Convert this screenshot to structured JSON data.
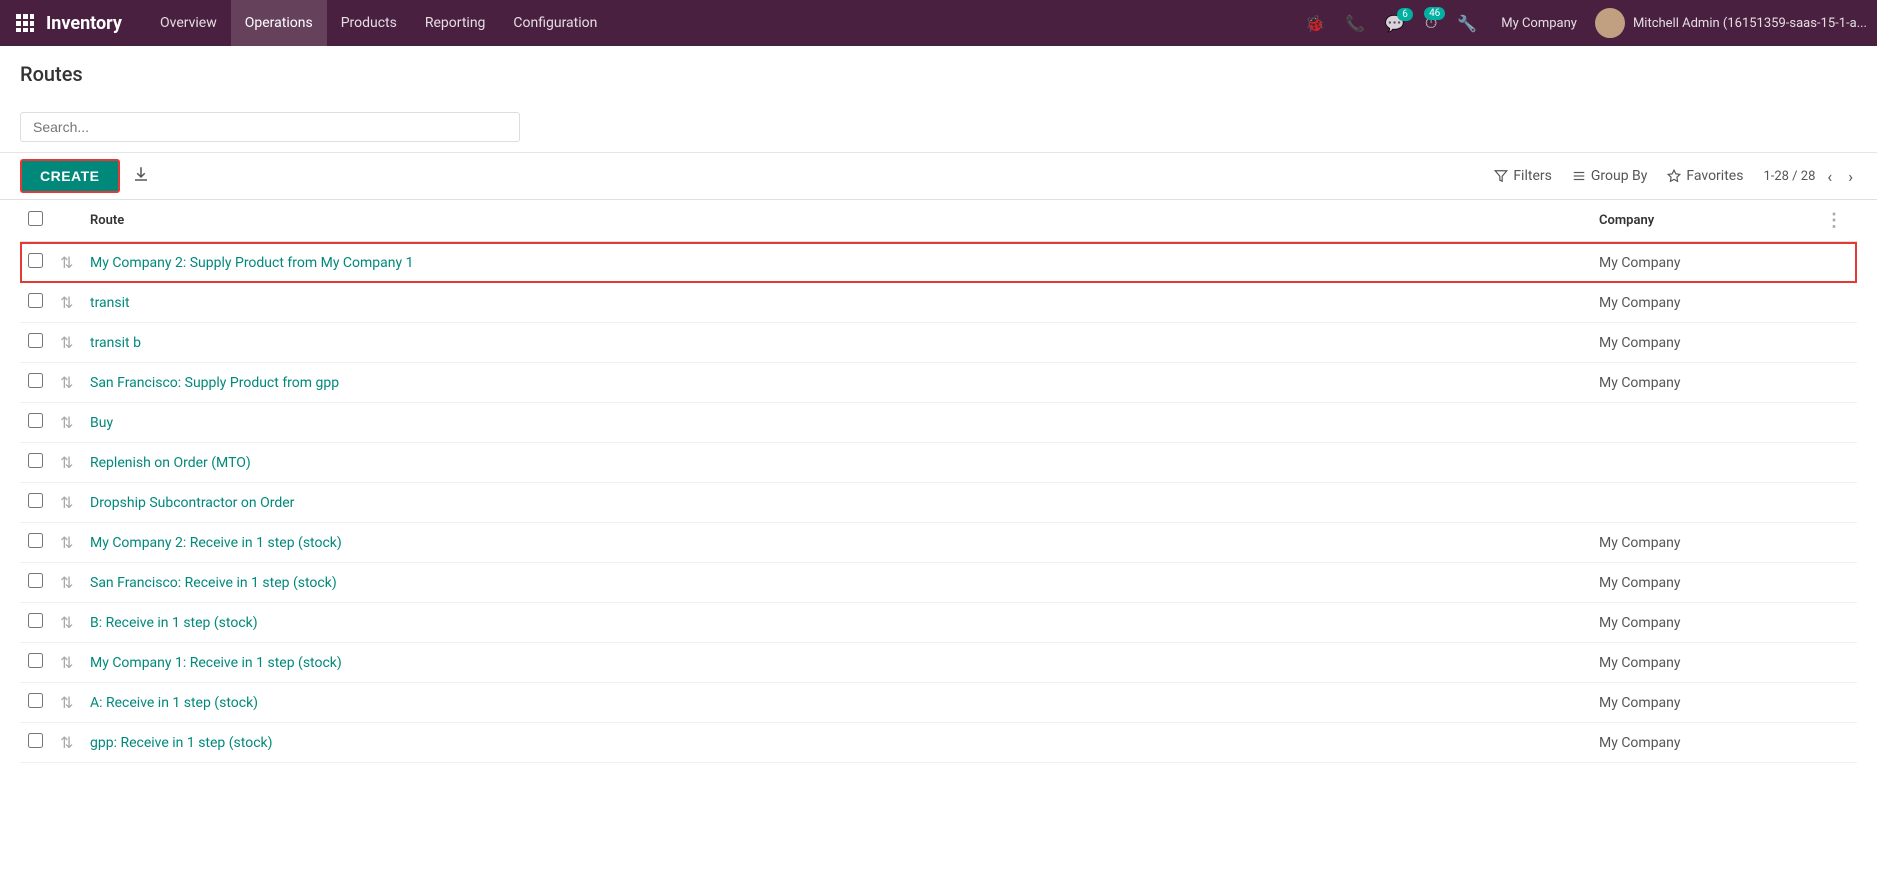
{
  "app": {
    "brand": "Inventory",
    "grid_icon": "⊞"
  },
  "nav": {
    "items": [
      {
        "label": "Overview",
        "active": false
      },
      {
        "label": "Operations",
        "active": false
      },
      {
        "label": "Products",
        "active": false
      },
      {
        "label": "Reporting",
        "active": false
      },
      {
        "label": "Configuration",
        "active": false
      }
    ]
  },
  "topnav_right": {
    "bug_icon": "🐞",
    "phone_icon": "📞",
    "chat_icon": "💬",
    "chat_badge": "6",
    "clock_icon": "⏰",
    "clock_badge": "46",
    "wrench_icon": "🔧",
    "company": "My Company",
    "username": "Mitchell Admin (16151359-saas-15-1-a..."
  },
  "page": {
    "title": "Routes",
    "search_placeholder": "Search..."
  },
  "toolbar": {
    "create_label": "CREATE",
    "filters_label": "Filters",
    "group_by_label": "Group By",
    "favorites_label": "Favorites",
    "pagination": "1-28 / 28"
  },
  "table": {
    "columns": [
      {
        "key": "route",
        "label": "Route"
      },
      {
        "key": "company",
        "label": "Company"
      }
    ],
    "rows": [
      {
        "id": 1,
        "route": "My Company 2: Supply Product from My Company 1",
        "company": "My Company",
        "highlighted": true
      },
      {
        "id": 2,
        "route": "transit",
        "company": "My Company",
        "highlighted": false
      },
      {
        "id": 3,
        "route": "transit b",
        "company": "My Company",
        "highlighted": false
      },
      {
        "id": 4,
        "route": "San Francisco: Supply Product from gpp",
        "company": "My Company",
        "highlighted": false
      },
      {
        "id": 5,
        "route": "Buy",
        "company": "",
        "highlighted": false
      },
      {
        "id": 6,
        "route": "Replenish on Order (MTO)",
        "company": "",
        "highlighted": false
      },
      {
        "id": 7,
        "route": "Dropship Subcontractor on Order",
        "company": "",
        "highlighted": false
      },
      {
        "id": 8,
        "route": "My Company 2: Receive in 1 step (stock)",
        "company": "My Company",
        "highlighted": false
      },
      {
        "id": 9,
        "route": "San Francisco: Receive in 1 step (stock)",
        "company": "My Company",
        "highlighted": false
      },
      {
        "id": 10,
        "route": "B: Receive in 1 step (stock)",
        "company": "My Company",
        "highlighted": false
      },
      {
        "id": 11,
        "route": "My Company 1: Receive in 1 step (stock)",
        "company": "My Company",
        "highlighted": false
      },
      {
        "id": 12,
        "route": "A: Receive in 1 step (stock)",
        "company": "My Company",
        "highlighted": false
      },
      {
        "id": 13,
        "route": "gpp: Receive in 1 step (stock)",
        "company": "My Company",
        "highlighted": false
      }
    ]
  }
}
